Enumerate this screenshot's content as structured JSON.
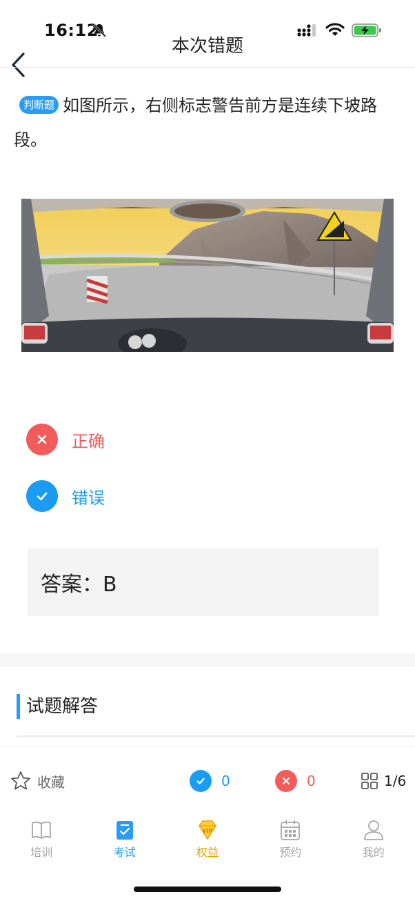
{
  "status_bar": {
    "time": "16:12"
  },
  "header": {
    "title": "本次错题"
  },
  "question": {
    "type_badge": "判断题",
    "text": "如图所示，右侧标志警告前方是连续下坡路段。"
  },
  "options": [
    {
      "label": "正确",
      "state": "wrong"
    },
    {
      "label": "错误",
      "state": "correct"
    }
  ],
  "answer": {
    "text": "答案：B"
  },
  "explanation": {
    "title": "试题解答"
  },
  "action_bar": {
    "favorite_label": "收藏",
    "correct_count": "0",
    "wrong_count": "0",
    "progress": "1/6"
  },
  "tabbar": {
    "items": [
      {
        "label": "培训",
        "icon": "book-icon"
      },
      {
        "label": "考试",
        "icon": "exam-icon"
      },
      {
        "label": "权益",
        "icon": "vip-diamond-icon"
      },
      {
        "label": "预约",
        "icon": "calendar-icon"
      },
      {
        "label": "我的",
        "icon": "person-icon"
      }
    ],
    "active": "考试"
  },
  "colors": {
    "accent_blue": "#1a9cf3",
    "error_red": "#f25b5b",
    "vip_gold": "#f0a000"
  }
}
